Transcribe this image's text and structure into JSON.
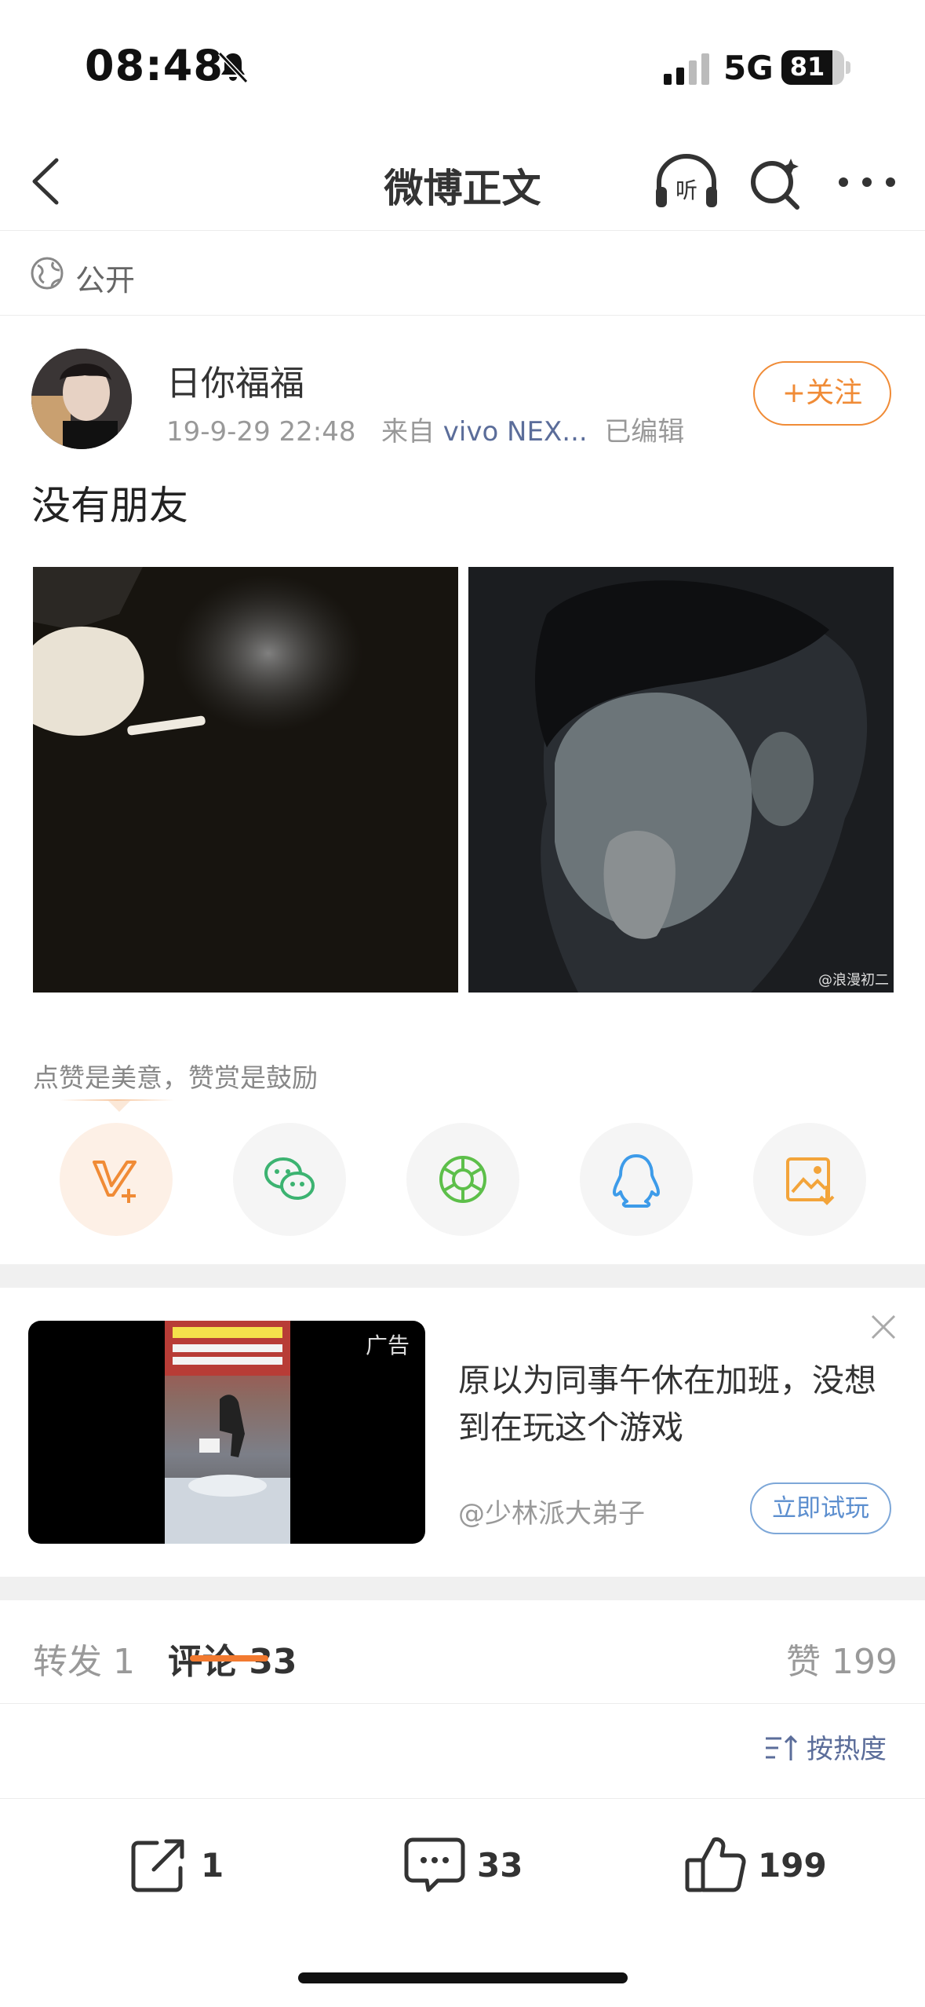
{
  "status_bar": {
    "time": "08:48",
    "network": "5G",
    "battery": "81",
    "battery_level": 0.81
  },
  "nav": {
    "title": "微博正文"
  },
  "visibility": {
    "label": "公开"
  },
  "post": {
    "username": "日你福福",
    "date": "19-9-29 22:48",
    "source_prefix": "来自",
    "source": "vivo NEX...",
    "edited": "已编辑",
    "follow_label": "+关注",
    "text": "没有朋友",
    "images": [
      {
        "watermark": ""
      },
      {
        "watermark": "@浪漫初二"
      }
    ]
  },
  "share": {
    "praise_text": "点赞是美意，赞赏是鼓励",
    "buttons": [
      "v-plus-icon",
      "wechat-icon",
      "moments-icon",
      "qq-icon",
      "save-image-icon"
    ]
  },
  "ad": {
    "tag": "广告",
    "title": "原以为同事午休在加班，没想到在玩这个游戏",
    "user": "@少林派大弟子",
    "cta": "立即试玩"
  },
  "tabs": {
    "repost": "转发 1",
    "comment": "评论 33",
    "like": "赞 199"
  },
  "sort": {
    "label": "按热度"
  },
  "actions": {
    "repost_count": "1",
    "comment_count": "33",
    "like_count": "199"
  }
}
